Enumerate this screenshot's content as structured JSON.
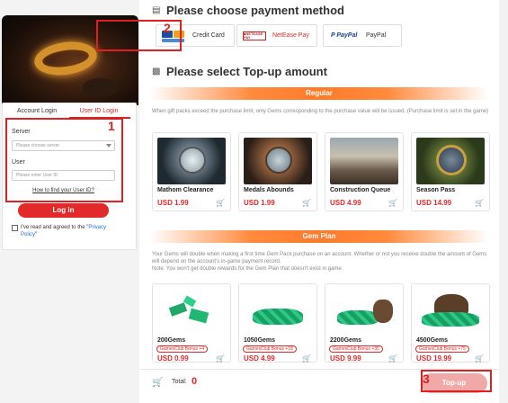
{
  "login": {
    "tabs": [
      {
        "label": "Account Login",
        "active": false
      },
      {
        "label": "User ID Login",
        "active": true
      }
    ],
    "server_label": "Server",
    "server_placeholder": "Please choose server",
    "user_label": "User",
    "user_placeholder": "Please enter User ID",
    "find_link": "How to find your User ID?",
    "login_button": "Log in",
    "agree_text": "I've read and agreed to the \"",
    "agree_policy": "Privacy Policy",
    "agree_end": "\""
  },
  "payment": {
    "title": "Please choose payment method",
    "methods": [
      {
        "label": "Credit Card",
        "icon": "credit-card-icons"
      },
      {
        "label": "NetEase Pay",
        "icon": "netease-pay-icon",
        "selected": true
      },
      {
        "label": "PayPal",
        "icon": "paypal-icon"
      }
    ]
  },
  "topup": {
    "title": "Please select Top-up amount",
    "regular_label": "Regular",
    "regular_note": "When gift packs exceed the purchase limit, only Gems corresponding to the purchase value will be issued. (Purchase limit is set in the game)",
    "regular_items": [
      {
        "name": "Mathom Clearance",
        "price": "USD 1.99"
      },
      {
        "name": "Medals Abounds",
        "price": "USD 1.99"
      },
      {
        "name": "Construction Queue",
        "price": "USD 4.99"
      },
      {
        "name": "Season Pass",
        "price": "USD 14.99"
      }
    ],
    "gem_label": "Gem Plan",
    "gem_note": "Your Gems will double when making a first time Gem Pack purchase on an account. Whether or not you receive double the amount of Gems will depend on the account's in-game payment record.\nNote: You won't get double rewards for the Gem Plan that doesn't exist in game.",
    "gem_items": [
      {
        "name": "200Gems",
        "bonus": "GamesClub Bonus +4",
        "price": "USD 0.99"
      },
      {
        "name": "1050Gems",
        "bonus": "GamesClub Bonus +18",
        "price": "USD 4.99"
      },
      {
        "name": "2200Gems",
        "bonus": "GamesClub Bonus +35",
        "price": "USD 9.99"
      },
      {
        "name": "4500Gems",
        "bonus": "GamesClub Bonus +75",
        "price": "USD 19.99"
      }
    ]
  },
  "footer": {
    "total_label": "Total:",
    "total_value": "0",
    "topup_button": "Top-up"
  },
  "annotations": {
    "badge1": "1",
    "badge2": "2",
    "badge3": "3"
  },
  "colors": {
    "accent": "#e02a2a",
    "bar": "#ff8a3d",
    "highlight_box": "#e02020"
  }
}
